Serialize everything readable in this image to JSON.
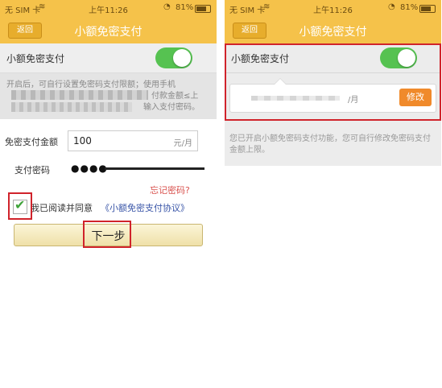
{
  "status_bar": {
    "carrier": "无 SIM 卡",
    "time": "上午11:26",
    "battery": "81%"
  },
  "left": {
    "nav": {
      "back": "返回",
      "title": "小额免密支付"
    },
    "toggle_label": "小额免密支付",
    "toggle_on": true,
    "desc_lines": [
      "开启后，可自行设置免密码支付限额；使用手机",
      "付时，付款金额≤上",
      "输入支付密码。"
    ],
    "amount_label": "免密支付金额",
    "amount_value": "100",
    "amount_unit": "元/月",
    "password_label": "支付密码",
    "password_dots": "●●●●",
    "forgot": "忘记密码?",
    "agree_checked": true,
    "agree_text": "我已阅读并同意",
    "agree_link": "《小额免密支付协议》",
    "next_button": "下一步"
  },
  "right": {
    "nav": {
      "back": "返回",
      "title": "小额免密支付"
    },
    "toggle_label": "小额免密支付",
    "toggle_on": true,
    "limit_unit": "/月",
    "edit_button": "修改",
    "desc": "您已开启小额免密码支付功能，您可自行修改免密码支付金额上限。"
  },
  "colors": {
    "header": "#f5c24a",
    "toggle_on": "#56c251",
    "highlight": "#d0232b",
    "edit_button": "#f08a2b",
    "link": "#3a56a8",
    "forgot": "#d9534f"
  },
  "icons": [
    "wifi-icon",
    "lock-icon",
    "battery-icon",
    "checkmark-icon"
  ]
}
